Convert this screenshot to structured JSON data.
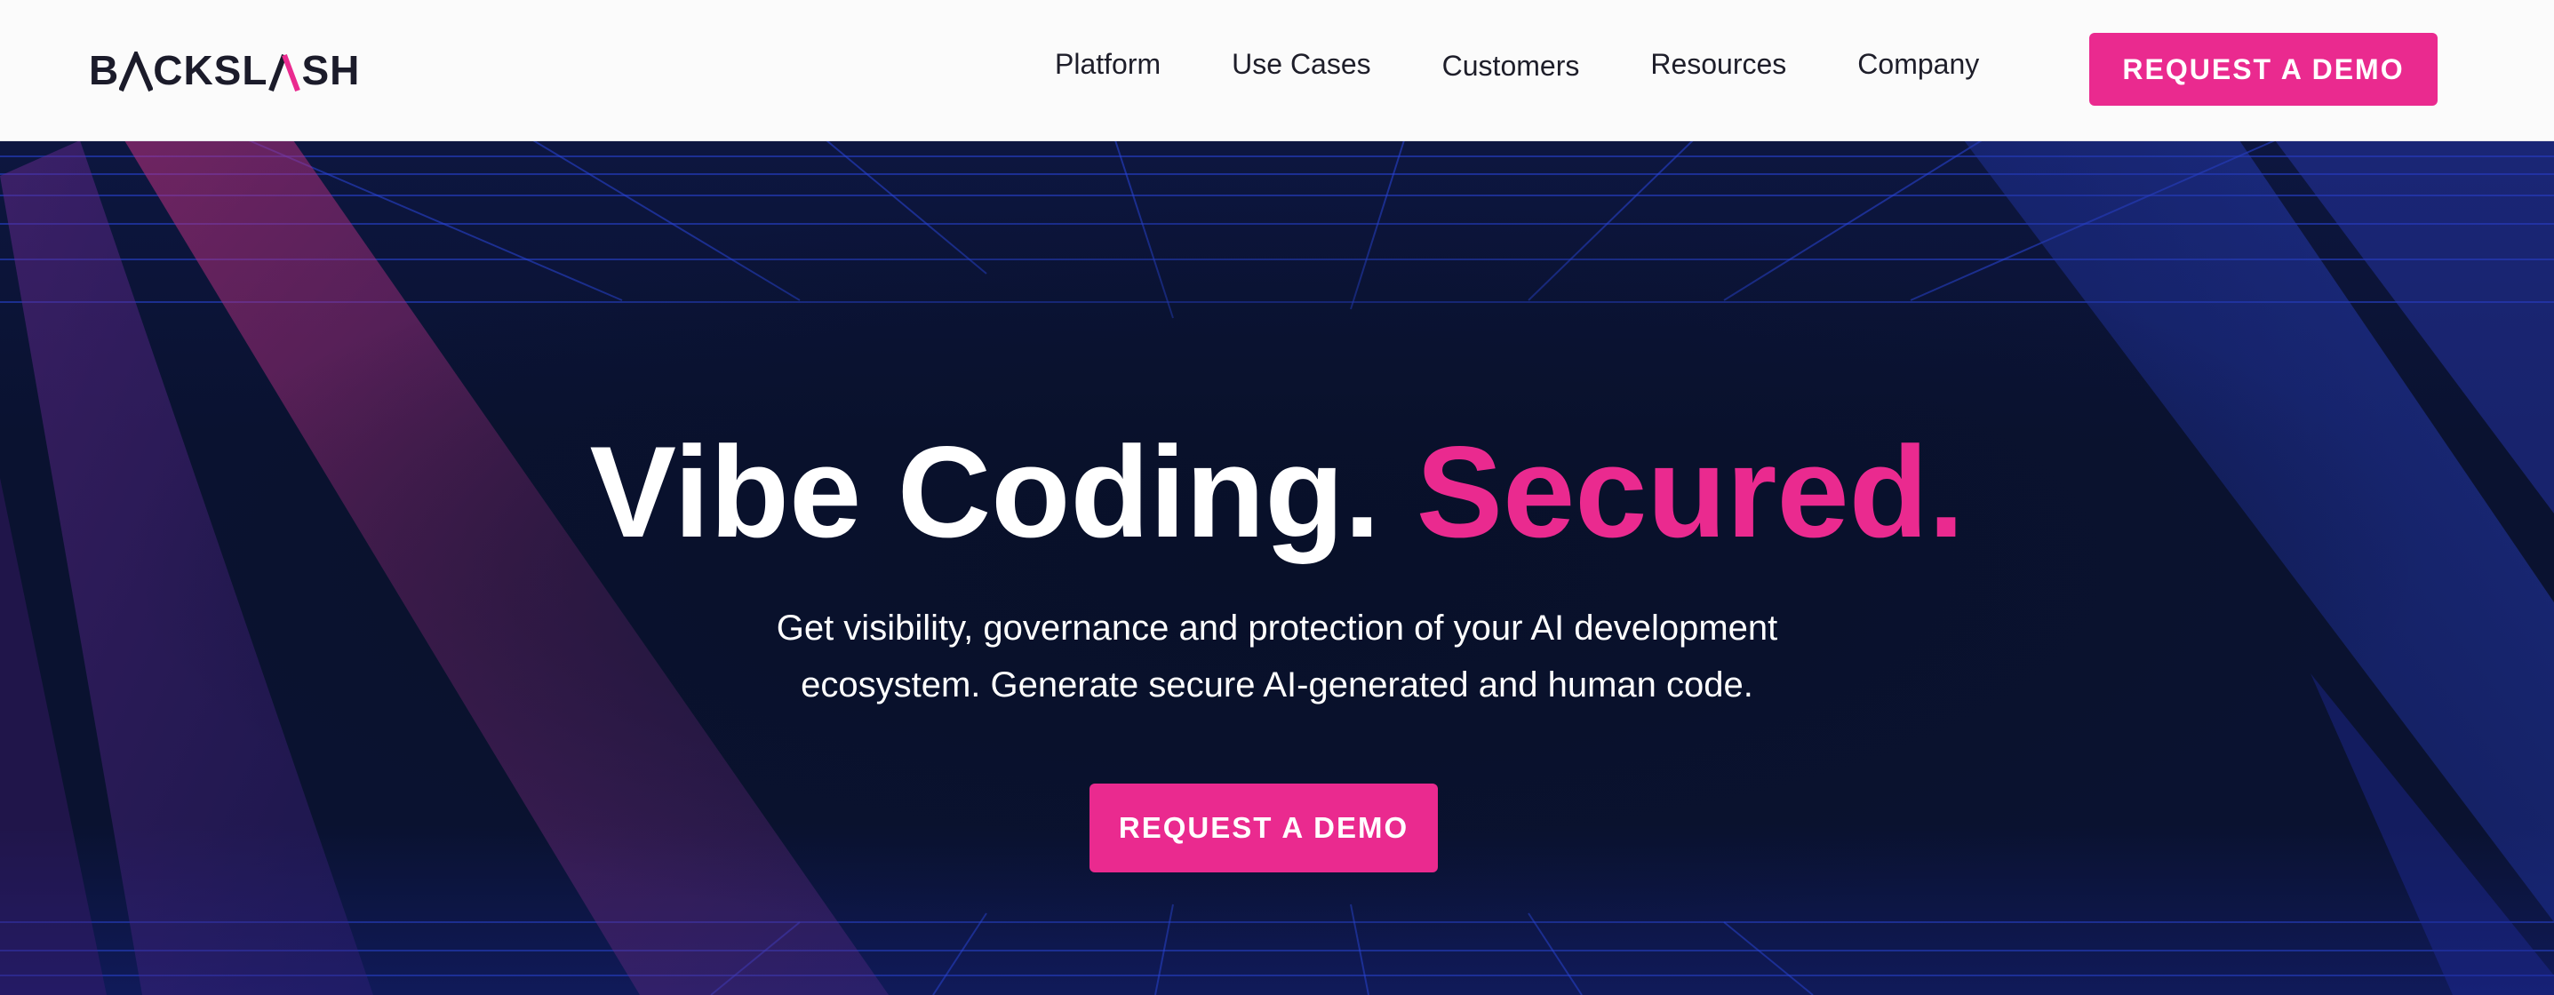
{
  "colors": {
    "accent": "#ea2a8f",
    "header_bg": "#fbfbfb",
    "hero_bg": "#0b1330",
    "text_dark": "#1e1e2a",
    "text_light": "#ffffff"
  },
  "header": {
    "logo": {
      "before": "B",
      "mark": "Λ",
      "middle": "CKSL",
      "slash": "/",
      "after": "SH",
      "icon": "backslash-logo"
    },
    "nav": [
      {
        "label": "Platform"
      },
      {
        "label": "Use Cases"
      },
      {
        "label": "Customers"
      },
      {
        "label": "Resources"
      },
      {
        "label": "Company"
      }
    ],
    "cta_label": "REQUEST A DEMO"
  },
  "hero": {
    "headline_main": "Vibe Coding.",
    "headline_accent": "Secured.",
    "subtitle_line1": "Get visibility, governance and protection of your AI development",
    "subtitle_line2": "ecosystem. Generate secure AI-generated and human code.",
    "cta_label": "REQUEST A DEMO"
  }
}
